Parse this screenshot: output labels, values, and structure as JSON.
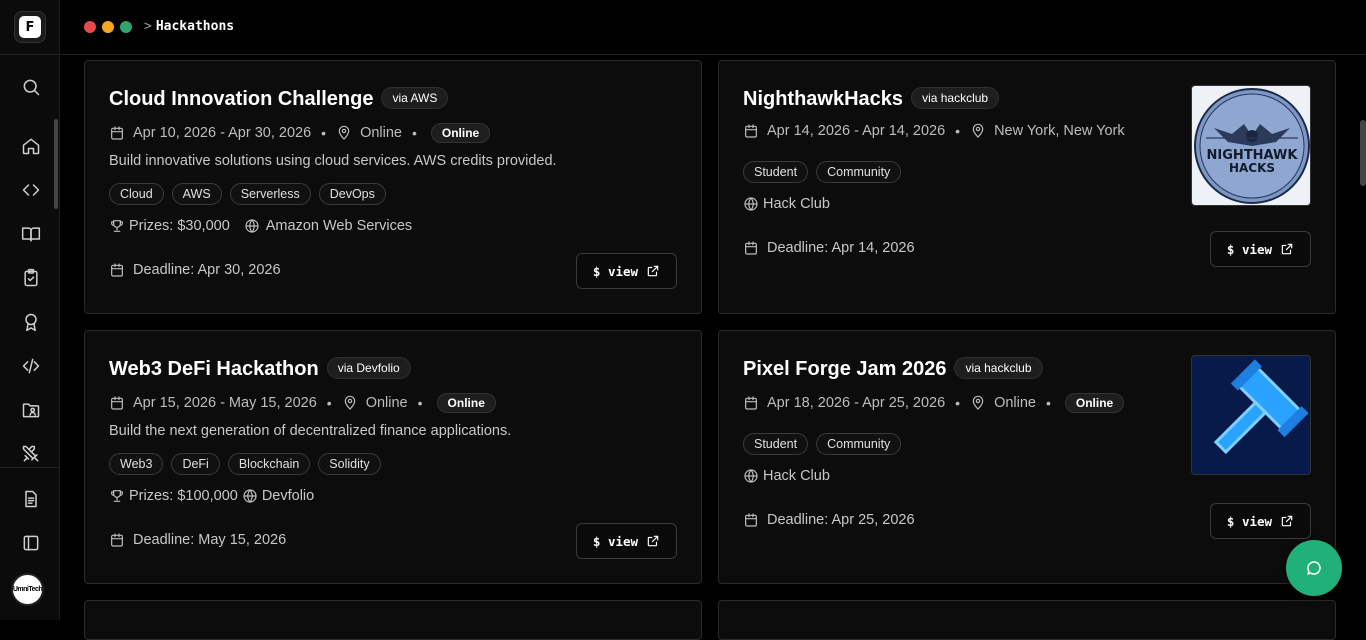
{
  "app": {
    "logo_letter": "F",
    "avatar_text": "UmniTech"
  },
  "breadcrumb": {
    "separator": ">",
    "current": "Hackathons"
  },
  "window_controls": {
    "close_color": "#e5484d",
    "minimize_color": "#f5a623",
    "maximize_color": "#30a46c"
  },
  "sidebar": {
    "items": [
      {
        "icon": "search-icon"
      },
      {
        "icon": "home-icon"
      },
      {
        "icon": "code-brackets-icon"
      },
      {
        "icon": "book-icon"
      },
      {
        "icon": "clipboard-check-icon"
      },
      {
        "icon": "award-icon"
      },
      {
        "icon": "code-slash-icon"
      },
      {
        "icon": "folder-user-icon"
      },
      {
        "icon": "swords-icon"
      },
      {
        "icon": "document-icon"
      },
      {
        "icon": "panel-icon"
      }
    ]
  },
  "cards": [
    {
      "title": "Cloud Innovation Challenge",
      "via": "via AWS",
      "dates": "Apr 10, 2026 - Apr 30, 2026",
      "location": "Online",
      "mode": "Online",
      "description": "Build innovative solutions using cloud services. AWS credits provided.",
      "tags": [
        "Cloud",
        "AWS",
        "Serverless",
        "DevOps"
      ],
      "prizes": "Prizes: $30,000",
      "organizer": "Amazon Web Services",
      "deadline": "Deadline: Apr 30, 2026",
      "button": "$ view"
    },
    {
      "title": "NighthawkHacks",
      "via": "via hackclub",
      "dates": "Apr 14, 2026 - Apr 14, 2026",
      "location": "New York, New York",
      "tags": [
        "Student",
        "Community"
      ],
      "organizer": "Hack Club",
      "deadline": "Deadline: Apr 14, 2026",
      "button": "$ view",
      "logo_text_1": "NIGHTHAWK",
      "logo_text_2": "HACKS"
    },
    {
      "title": "Web3 DeFi Hackathon",
      "via": "via Devfolio",
      "dates": "Apr 15, 2026 - May 15, 2026",
      "location": "Online",
      "mode": "Online",
      "description": "Build the next generation of decentralized finance applications.",
      "tags": [
        "Web3",
        "DeFi",
        "Blockchain",
        "Solidity"
      ],
      "prizes": "Prizes: $100,000",
      "organizer": "Devfolio",
      "deadline": "Deadline: May 15, 2026",
      "button": "$ view"
    },
    {
      "title": "Pixel Forge Jam 2026",
      "via": "via hackclub",
      "dates": "Apr 18, 2026 - Apr 25, 2026",
      "location": "Online",
      "mode": "Online",
      "tags": [
        "Student",
        "Community"
      ],
      "organizer": "Hack Club",
      "deadline": "Deadline: Apr 25, 2026",
      "button": "$ view"
    }
  ],
  "chat": {
    "icon": "chat-icon",
    "color": "#22b07a"
  }
}
